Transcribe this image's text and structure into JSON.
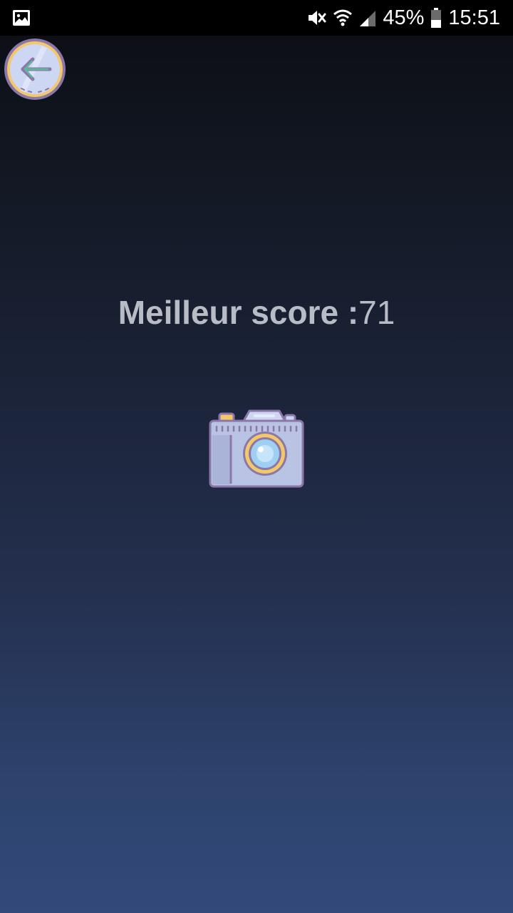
{
  "status_bar": {
    "left_icon": "gallery-notification-icon",
    "icons": [
      "mute-vibrate-icon",
      "wifi-icon",
      "signal-icon",
      "battery-icon"
    ],
    "battery": "45%",
    "battery_level": 0.45,
    "time": "15:51"
  },
  "toolbar": {
    "back_icon": "back-arrow-icon"
  },
  "main": {
    "score_label": "Meilleur score :",
    "score_value": "71",
    "camera_icon": "camera-icon"
  },
  "colors": {
    "status_bar_bg": "#000000",
    "gradient_top": "#0b0d12",
    "gradient_bottom": "#33497a",
    "score_text": "#b8bcc5",
    "icon_fill": "#b9c3e3",
    "icon_outline": "#8b78a8",
    "icon_accent": "#f2c86a"
  }
}
